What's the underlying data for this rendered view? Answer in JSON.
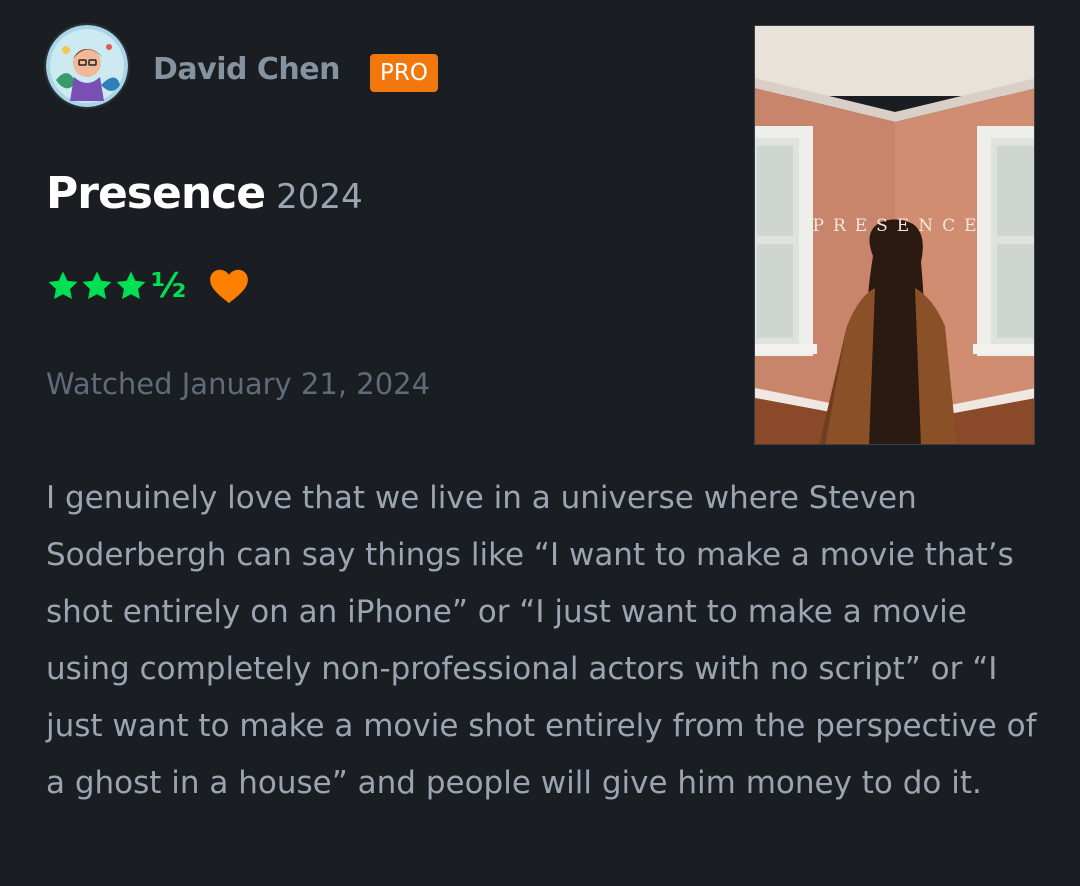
{
  "header": {
    "username": "David Chen",
    "badge": "PRO"
  },
  "film": {
    "title": "Presence",
    "year": "2024",
    "poster_title": "PRESENCE"
  },
  "rating": {
    "full_stars": 3,
    "half_star": "½",
    "liked": true,
    "star_color": "#00e054",
    "heart_color": "#ff8000"
  },
  "watched": {
    "text": "Watched January 21, 2024"
  },
  "review": {
    "text": "I genuinely love that we live in a universe where Steven Soderbergh can say things like “I want to make a movie that’s shot entirely on an iPhone” or “I just want to make a movie using completely non-professional actors with no script” or “I just want to make a movie shot entirely from the perspective of a ghost in a house” and people will give him money to do it."
  },
  "icons": {
    "star": "star-icon",
    "heart": "heart-icon"
  },
  "colors": {
    "background": "#1a1d22",
    "badge": "#f2770c",
    "title": "#ffffff",
    "body_text": "#9aa5b1",
    "muted_text": "#5f6b78"
  }
}
